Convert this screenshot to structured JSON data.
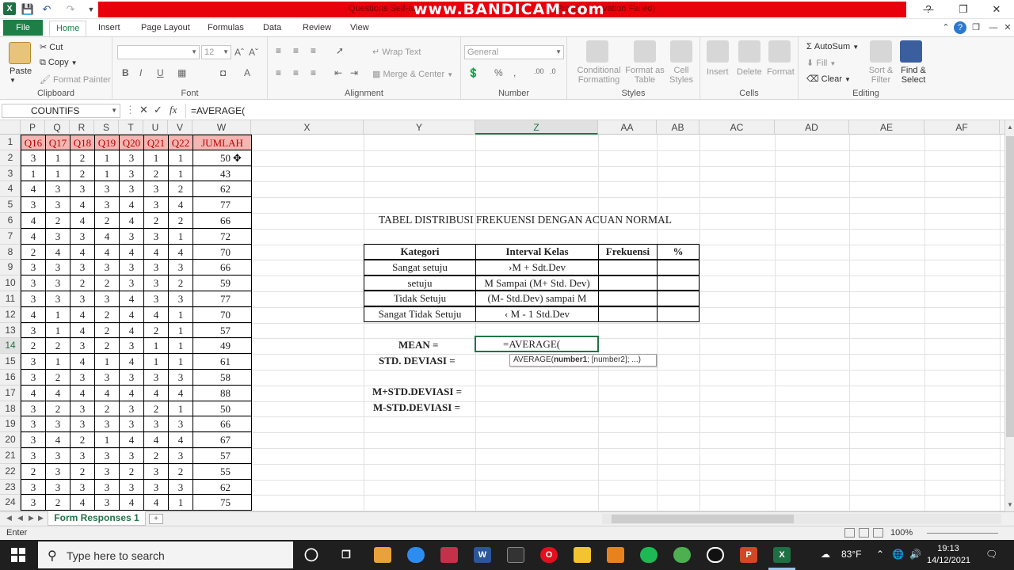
{
  "titlebar": {
    "title": "Questions Self-a...",
    "activation": "(Product Activation Failed)",
    "watermark": "www.BANDICAM.com"
  },
  "tabs": {
    "file": "File",
    "items": [
      "Home",
      "Insert",
      "Page Layout",
      "Formulas",
      "Data",
      "Review",
      "View"
    ]
  },
  "ribbon": {
    "clipboard": {
      "label": "Clipboard",
      "paste": "Paste",
      "cut": "Cut",
      "copy": "Copy",
      "format_painter": "Format Painter"
    },
    "font": {
      "label": "Font",
      "font_name": "",
      "font_size": "12"
    },
    "alignment": {
      "label": "Alignment",
      "wrap_text": "Wrap Text",
      "merge_center": "Merge & Center"
    },
    "number": {
      "label": "Number",
      "format": "General",
      "percent": "%",
      "comma": ","
    },
    "styles": {
      "label": "Styles",
      "conditional_formatting": "Conditional Formatting",
      "format_as_table": "Format as Table",
      "cell_styles": "Cell Styles"
    },
    "cells": {
      "label": "Cells",
      "insert": "Insert",
      "delete": "Delete",
      "format": "Format"
    },
    "editing": {
      "label": "Editing",
      "autosum": "AutoSum",
      "fill": "Fill",
      "clear": "Clear",
      "sort_filter": "Sort & Filter",
      "find_select": "Find & Select"
    }
  },
  "formula_bar": {
    "name_box": "COUNTIFS",
    "fx": "fx",
    "formula": "=AVERAGE("
  },
  "grid": {
    "columns": [
      "P",
      "Q",
      "R",
      "S",
      "T",
      "U",
      "V",
      "W",
      "X",
      "Y",
      "Z",
      "AA",
      "AB",
      "AC",
      "AD",
      "AE",
      "AF"
    ],
    "rows": [
      "1",
      "2",
      "3",
      "4",
      "5",
      "6",
      "7",
      "8",
      "9",
      "10",
      "11",
      "12",
      "13",
      "14",
      "15",
      "16",
      "17",
      "18",
      "19",
      "20",
      "21",
      "22",
      "23",
      "24"
    ],
    "headers": [
      "Q16",
      "Q17",
      "Q18",
      "Q19",
      "Q20",
      "Q21",
      "Q22",
      "JUMLAH"
    ],
    "data": [
      [
        3,
        1,
        2,
        1,
        3,
        1,
        1,
        50
      ],
      [
        1,
        1,
        2,
        1,
        3,
        2,
        1,
        43
      ],
      [
        4,
        3,
        3,
        3,
        3,
        3,
        2,
        62
      ],
      [
        3,
        3,
        4,
        3,
        4,
        3,
        4,
        77
      ],
      [
        4,
        2,
        4,
        2,
        4,
        2,
        2,
        66
      ],
      [
        4,
        3,
        3,
        4,
        3,
        3,
        1,
        72
      ],
      [
        2,
        4,
        4,
        4,
        4,
        4,
        4,
        70
      ],
      [
        3,
        3,
        3,
        3,
        3,
        3,
        3,
        66
      ],
      [
        3,
        3,
        2,
        2,
        3,
        3,
        2,
        59
      ],
      [
        3,
        3,
        3,
        3,
        4,
        3,
        3,
        77
      ],
      [
        4,
        1,
        4,
        2,
        4,
        4,
        1,
        70
      ],
      [
        3,
        1,
        4,
        2,
        4,
        2,
        1,
        57
      ],
      [
        2,
        2,
        3,
        2,
        3,
        1,
        1,
        49
      ],
      [
        3,
        1,
        4,
        1,
        4,
        1,
        1,
        61
      ],
      [
        3,
        2,
        3,
        3,
        3,
        3,
        3,
        58
      ],
      [
        4,
        4,
        4,
        4,
        4,
        4,
        4,
        88
      ],
      [
        3,
        2,
        3,
        2,
        3,
        2,
        1,
        50
      ],
      [
        3,
        3,
        3,
        3,
        3,
        3,
        3,
        66
      ],
      [
        3,
        4,
        2,
        1,
        4,
        4,
        4,
        67
      ],
      [
        3,
        3,
        3,
        3,
        3,
        2,
        3,
        57
      ],
      [
        2,
        3,
        2,
        3,
        2,
        3,
        2,
        55
      ],
      [
        3,
        3,
        3,
        3,
        3,
        3,
        3,
        62
      ],
      [
        3,
        2,
        4,
        3,
        4,
        4,
        1,
        75
      ]
    ]
  },
  "dist_table": {
    "title": "TABEL DISTRIBUSI FREKUENSI DENGAN ACUAN NORMAL",
    "headers": [
      "Kategori",
      "Interval Kelas",
      "Frekuensi",
      "%"
    ],
    "rows": [
      [
        "Sangat setuju",
        "›M + Sdt.Dev"
      ],
      [
        "setuju",
        "M Sampai (M+ Std. Dev)"
      ],
      [
        "Tidak Setuju",
        "(M- Std.Dev) sampai M"
      ],
      [
        "Sangat Tidak Setuju",
        "‹ M - 1 Std.Dev"
      ]
    ],
    "mean_label": "MEAN =",
    "std_label": "STD. DEVIASI =",
    "m_plus_label": "M+STD.DEVIASI =",
    "m_minus_label": "M-STD.DEVIASI =",
    "active_value": "=AVERAGE(",
    "tooltip_fn": "AVERAGE(",
    "tooltip_arg1": "number1",
    "tooltip_rest": "; [number2]; ...)"
  },
  "sheets": {
    "active": "Form Responses 1"
  },
  "status": {
    "mode": "Enter",
    "zoom": "100%"
  },
  "taskbar": {
    "search_placeholder": "Type here to search",
    "weather": "83°F",
    "time": "19:13",
    "date": "14/12/2021"
  },
  "colors": {
    "accent": "#217346",
    "header_fill": "#f4b6b2",
    "header_text": "#c00000",
    "title_red": "#e8000a"
  }
}
